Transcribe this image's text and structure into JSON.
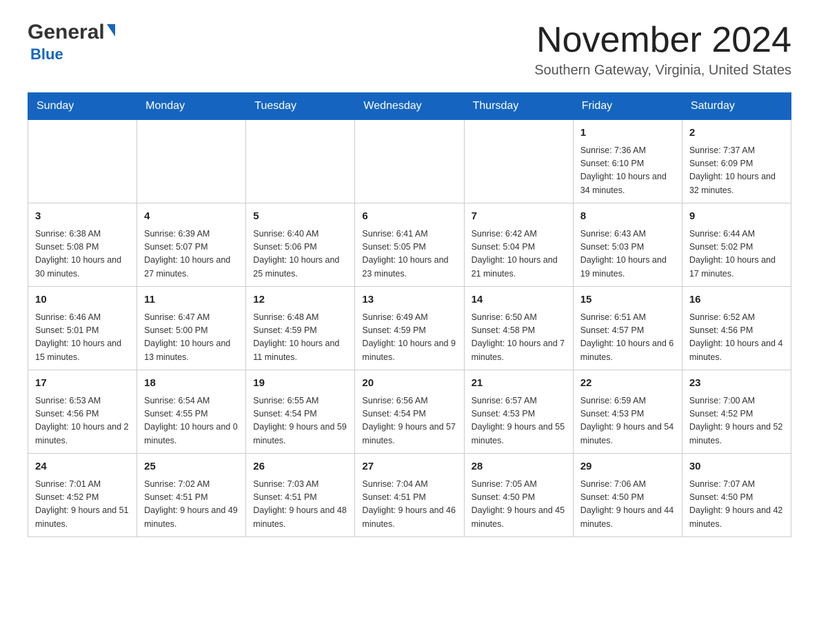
{
  "header": {
    "logo_general": "General",
    "logo_blue": "Blue",
    "month_title": "November 2024",
    "location": "Southern Gateway, Virginia, United States"
  },
  "days_of_week": [
    "Sunday",
    "Monday",
    "Tuesday",
    "Wednesday",
    "Thursday",
    "Friday",
    "Saturday"
  ],
  "weeks": [
    [
      {
        "day": "",
        "sunrise": "",
        "sunset": "",
        "daylight": ""
      },
      {
        "day": "",
        "sunrise": "",
        "sunset": "",
        "daylight": ""
      },
      {
        "day": "",
        "sunrise": "",
        "sunset": "",
        "daylight": ""
      },
      {
        "day": "",
        "sunrise": "",
        "sunset": "",
        "daylight": ""
      },
      {
        "day": "",
        "sunrise": "",
        "sunset": "",
        "daylight": ""
      },
      {
        "day": "1",
        "sunrise": "Sunrise: 7:36 AM",
        "sunset": "Sunset: 6:10 PM",
        "daylight": "Daylight: 10 hours and 34 minutes."
      },
      {
        "day": "2",
        "sunrise": "Sunrise: 7:37 AM",
        "sunset": "Sunset: 6:09 PM",
        "daylight": "Daylight: 10 hours and 32 minutes."
      }
    ],
    [
      {
        "day": "3",
        "sunrise": "Sunrise: 6:38 AM",
        "sunset": "Sunset: 5:08 PM",
        "daylight": "Daylight: 10 hours and 30 minutes."
      },
      {
        "day": "4",
        "sunrise": "Sunrise: 6:39 AM",
        "sunset": "Sunset: 5:07 PM",
        "daylight": "Daylight: 10 hours and 27 minutes."
      },
      {
        "day": "5",
        "sunrise": "Sunrise: 6:40 AM",
        "sunset": "Sunset: 5:06 PM",
        "daylight": "Daylight: 10 hours and 25 minutes."
      },
      {
        "day": "6",
        "sunrise": "Sunrise: 6:41 AM",
        "sunset": "Sunset: 5:05 PM",
        "daylight": "Daylight: 10 hours and 23 minutes."
      },
      {
        "day": "7",
        "sunrise": "Sunrise: 6:42 AM",
        "sunset": "Sunset: 5:04 PM",
        "daylight": "Daylight: 10 hours and 21 minutes."
      },
      {
        "day": "8",
        "sunrise": "Sunrise: 6:43 AM",
        "sunset": "Sunset: 5:03 PM",
        "daylight": "Daylight: 10 hours and 19 minutes."
      },
      {
        "day": "9",
        "sunrise": "Sunrise: 6:44 AM",
        "sunset": "Sunset: 5:02 PM",
        "daylight": "Daylight: 10 hours and 17 minutes."
      }
    ],
    [
      {
        "day": "10",
        "sunrise": "Sunrise: 6:46 AM",
        "sunset": "Sunset: 5:01 PM",
        "daylight": "Daylight: 10 hours and 15 minutes."
      },
      {
        "day": "11",
        "sunrise": "Sunrise: 6:47 AM",
        "sunset": "Sunset: 5:00 PM",
        "daylight": "Daylight: 10 hours and 13 minutes."
      },
      {
        "day": "12",
        "sunrise": "Sunrise: 6:48 AM",
        "sunset": "Sunset: 4:59 PM",
        "daylight": "Daylight: 10 hours and 11 minutes."
      },
      {
        "day": "13",
        "sunrise": "Sunrise: 6:49 AM",
        "sunset": "Sunset: 4:59 PM",
        "daylight": "Daylight: 10 hours and 9 minutes."
      },
      {
        "day": "14",
        "sunrise": "Sunrise: 6:50 AM",
        "sunset": "Sunset: 4:58 PM",
        "daylight": "Daylight: 10 hours and 7 minutes."
      },
      {
        "day": "15",
        "sunrise": "Sunrise: 6:51 AM",
        "sunset": "Sunset: 4:57 PM",
        "daylight": "Daylight: 10 hours and 6 minutes."
      },
      {
        "day": "16",
        "sunrise": "Sunrise: 6:52 AM",
        "sunset": "Sunset: 4:56 PM",
        "daylight": "Daylight: 10 hours and 4 minutes."
      }
    ],
    [
      {
        "day": "17",
        "sunrise": "Sunrise: 6:53 AM",
        "sunset": "Sunset: 4:56 PM",
        "daylight": "Daylight: 10 hours and 2 minutes."
      },
      {
        "day": "18",
        "sunrise": "Sunrise: 6:54 AM",
        "sunset": "Sunset: 4:55 PM",
        "daylight": "Daylight: 10 hours and 0 minutes."
      },
      {
        "day": "19",
        "sunrise": "Sunrise: 6:55 AM",
        "sunset": "Sunset: 4:54 PM",
        "daylight": "Daylight: 9 hours and 59 minutes."
      },
      {
        "day": "20",
        "sunrise": "Sunrise: 6:56 AM",
        "sunset": "Sunset: 4:54 PM",
        "daylight": "Daylight: 9 hours and 57 minutes."
      },
      {
        "day": "21",
        "sunrise": "Sunrise: 6:57 AM",
        "sunset": "Sunset: 4:53 PM",
        "daylight": "Daylight: 9 hours and 55 minutes."
      },
      {
        "day": "22",
        "sunrise": "Sunrise: 6:59 AM",
        "sunset": "Sunset: 4:53 PM",
        "daylight": "Daylight: 9 hours and 54 minutes."
      },
      {
        "day": "23",
        "sunrise": "Sunrise: 7:00 AM",
        "sunset": "Sunset: 4:52 PM",
        "daylight": "Daylight: 9 hours and 52 minutes."
      }
    ],
    [
      {
        "day": "24",
        "sunrise": "Sunrise: 7:01 AM",
        "sunset": "Sunset: 4:52 PM",
        "daylight": "Daylight: 9 hours and 51 minutes."
      },
      {
        "day": "25",
        "sunrise": "Sunrise: 7:02 AM",
        "sunset": "Sunset: 4:51 PM",
        "daylight": "Daylight: 9 hours and 49 minutes."
      },
      {
        "day": "26",
        "sunrise": "Sunrise: 7:03 AM",
        "sunset": "Sunset: 4:51 PM",
        "daylight": "Daylight: 9 hours and 48 minutes."
      },
      {
        "day": "27",
        "sunrise": "Sunrise: 7:04 AM",
        "sunset": "Sunset: 4:51 PM",
        "daylight": "Daylight: 9 hours and 46 minutes."
      },
      {
        "day": "28",
        "sunrise": "Sunrise: 7:05 AM",
        "sunset": "Sunset: 4:50 PM",
        "daylight": "Daylight: 9 hours and 45 minutes."
      },
      {
        "day": "29",
        "sunrise": "Sunrise: 7:06 AM",
        "sunset": "Sunset: 4:50 PM",
        "daylight": "Daylight: 9 hours and 44 minutes."
      },
      {
        "day": "30",
        "sunrise": "Sunrise: 7:07 AM",
        "sunset": "Sunset: 4:50 PM",
        "daylight": "Daylight: 9 hours and 42 minutes."
      }
    ]
  ]
}
